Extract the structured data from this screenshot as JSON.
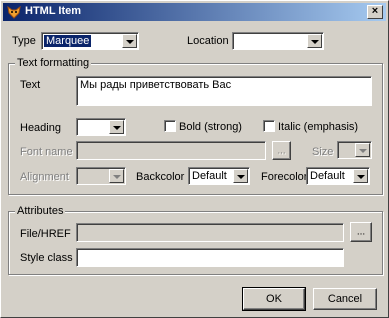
{
  "window": {
    "title": "HTML Item"
  },
  "type": {
    "label": "Type",
    "value": "Marquee"
  },
  "location": {
    "label": "Location",
    "value": ""
  },
  "text_formatting": {
    "legend": "Text formatting",
    "text_label": "Text",
    "text_value": "Мы рады приветствовать Вас",
    "heading_label": "Heading",
    "heading_value": "",
    "bold_label": "Bold (strong)",
    "italic_label": "Italic (emphasis)",
    "font_name_label": "Font name",
    "font_browse": "...",
    "size_label": "Size",
    "alignment_label": "Alignment",
    "backcolor_label": "Backcolor",
    "backcolor_value": "Default",
    "forecolor_label": "Forecolor",
    "forecolor_value": "Default"
  },
  "attributes": {
    "legend": "Attributes",
    "file_href_label": "File/HREF",
    "file_browse": "...",
    "style_class_label": "Style class",
    "style_class_value": ""
  },
  "buttons": {
    "ok": "OK",
    "cancel": "Cancel"
  },
  "colors": {
    "title_start": "#0a246a",
    "title_end": "#a6caf0",
    "face": "#d4d0c8"
  }
}
